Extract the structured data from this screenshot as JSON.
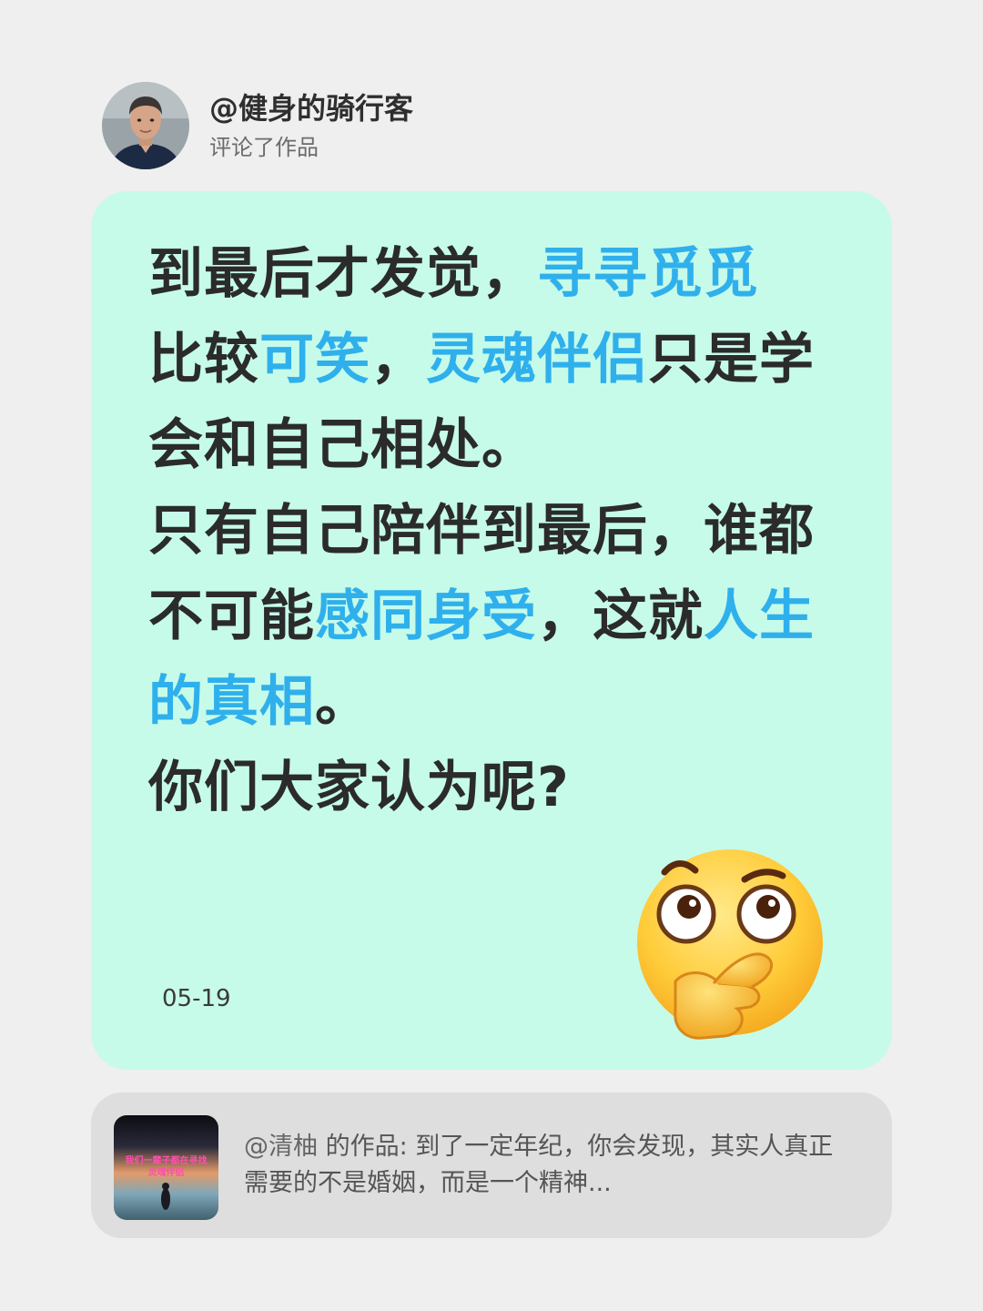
{
  "header": {
    "username": "@健身的骑行客",
    "action": "评论了作品"
  },
  "comment": {
    "segments": [
      {
        "text": "到最后才发觉，",
        "highlight": false
      },
      {
        "text": "寻寻觅觅",
        "highlight": true
      },
      {
        "text": "比较",
        "highlight": false
      },
      {
        "text": "可笑",
        "highlight": true
      },
      {
        "text": "，",
        "highlight": false
      },
      {
        "text": "灵魂伴侣",
        "highlight": true
      },
      {
        "text": "只是学会和自己相处。",
        "highlight": false
      },
      {
        "text": "只有自己陪伴到最后，谁都不可能",
        "highlight": false
      },
      {
        "text": "感同身受",
        "highlight": true
      },
      {
        "text": "，这就",
        "highlight": false
      },
      {
        "text": "人生的真相",
        "highlight": true
      },
      {
        "text": "。",
        "highlight": false
      },
      {
        "text": "你们大家认为呢?",
        "highlight": false
      }
    ],
    "date": "05-19",
    "emoji": "thinking-face-emoji"
  },
  "reference": {
    "author": "@清柚",
    "label": "的作品:",
    "excerpt": "到了一定年纪，你会发现，其实人真正需要的不是婚姻，而是一个精神...",
    "thumbnail_caption_line1": "我们一辈子都在寻找",
    "thumbnail_caption_line2": "灵魂伴侣"
  },
  "colors": {
    "background": "#efefef",
    "card": "#c6fbea",
    "highlight": "#2fb0ec",
    "reference_card": "#dedede"
  }
}
